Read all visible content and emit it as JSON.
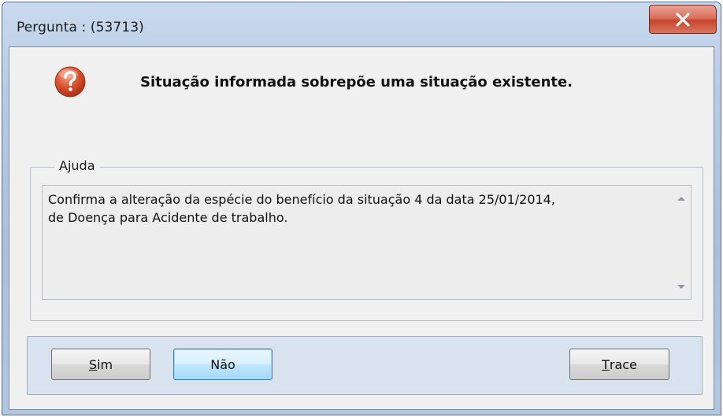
{
  "window": {
    "title": "Pergunta : (53713)",
    "close_icon": "close-x-icon"
  },
  "dialog": {
    "icon": "question-icon",
    "message": "Situação informada sobrepõe uma situação existente."
  },
  "help": {
    "legend": "Ajuda",
    "lines": [
      "Confirma a alteração da espécie do benefício da situação 4 da data 25/01/2014,",
      "de Doença para Acidente de trabalho."
    ]
  },
  "buttons": {
    "yes": {
      "mnemonic": "S",
      "rest": "im"
    },
    "no": {
      "label": "Não"
    },
    "trace": {
      "mnemonic": "T",
      "rest": "race"
    }
  },
  "colors": {
    "titlebar": "#b7cbe3",
    "close_button": "#c8452b",
    "question_icon": "#d9532f",
    "client_background": "#f0f0f0",
    "button_bar": "#d9e3f0",
    "focused_button": "#3c7fb1"
  }
}
